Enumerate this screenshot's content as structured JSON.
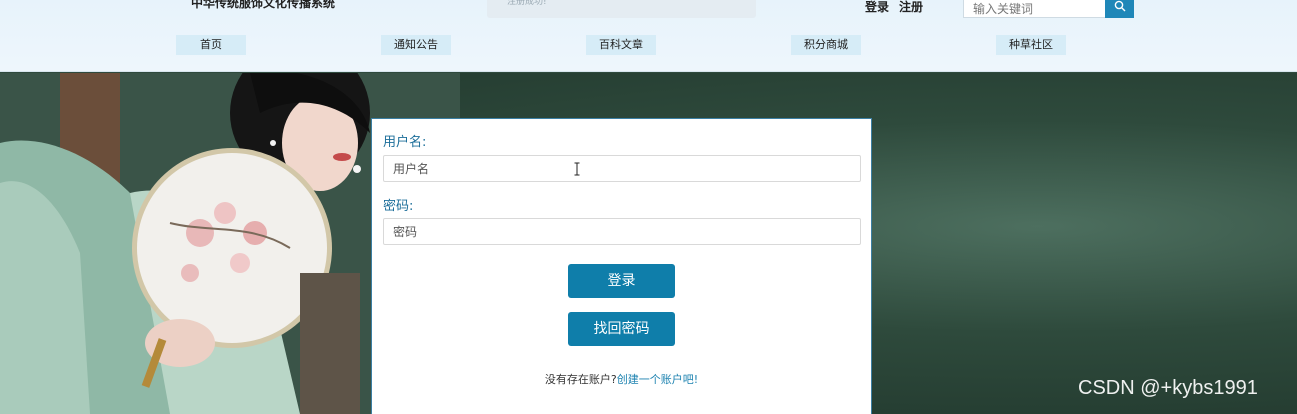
{
  "header": {
    "site_title": "中华传统服饰文化传播系统",
    "toast": "注册成功!",
    "login_link": "登录",
    "register_link": "注册",
    "search_placeholder": "输入关键词"
  },
  "nav": {
    "items": [
      {
        "label": "首页"
      },
      {
        "label": "通知公告"
      },
      {
        "label": "百科文章"
      },
      {
        "label": "积分商城"
      },
      {
        "label": "种草社区"
      }
    ]
  },
  "login_form": {
    "username_label": "用户名:",
    "username_placeholder": "用户名",
    "password_label": "密码:",
    "password_placeholder": "密码",
    "login_button": "登录",
    "recover_button": "找回密码",
    "no_account_text": "没有存在账户?",
    "create_account_link": "创建一个账户吧!"
  },
  "watermark": "CSDN @+kybs1991",
  "colors": {
    "accent": "#0f7eaa",
    "label_blue": "#1c6e9a",
    "nav_bg": "#d6ecf7",
    "header_bg": "#e7f3fb"
  }
}
